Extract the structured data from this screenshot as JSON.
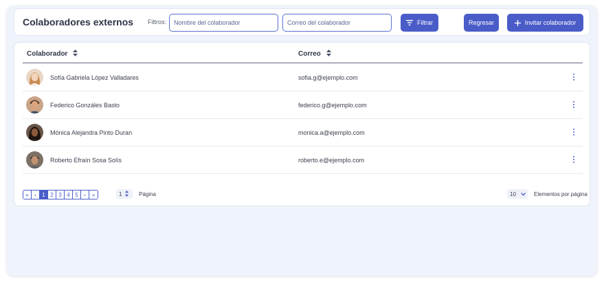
{
  "header": {
    "title": "Colaboradores externos",
    "filters_label": "Filtros:",
    "name_placeholder": "Nombre del colaborador",
    "email_placeholder": "Correo del colaborador",
    "filter_button": "Filtrar",
    "back_button": "Regresar",
    "invite_button": "Invitar colaborador"
  },
  "table": {
    "columns": [
      "Colaborador",
      "Correo"
    ],
    "rows": [
      {
        "name": "Sofía Gabriela López Valladares",
        "email": "sofia.g@ejemplo.com",
        "avatar": "female-avatar-light"
      },
      {
        "name": "Federico Gonzáles Basto",
        "email": "federico.g@ejemplo.com",
        "avatar": "male-avatar"
      },
      {
        "name": "Mónica Alejandra Pinto Duran",
        "email": "monica.a@ejemplo.com",
        "avatar": "female-avatar-dark"
      },
      {
        "name": "Roberto Efraín Sosa Solís",
        "email": "roberto.e@ejemplo.com",
        "avatar": "male-avatar-2"
      }
    ]
  },
  "pagination": {
    "first": "«",
    "prev": "‹",
    "pages": [
      "1",
      "2",
      "3",
      "4",
      "5"
    ],
    "active_page": "1",
    "next": "›",
    "last": "»",
    "current_page": "1",
    "page_label": "Página",
    "per_page": "10",
    "per_page_label": "Elementos por página"
  },
  "colors": {
    "accent": "#4a5cc8",
    "background": "#eff3fb",
    "card": "#ffffff"
  }
}
